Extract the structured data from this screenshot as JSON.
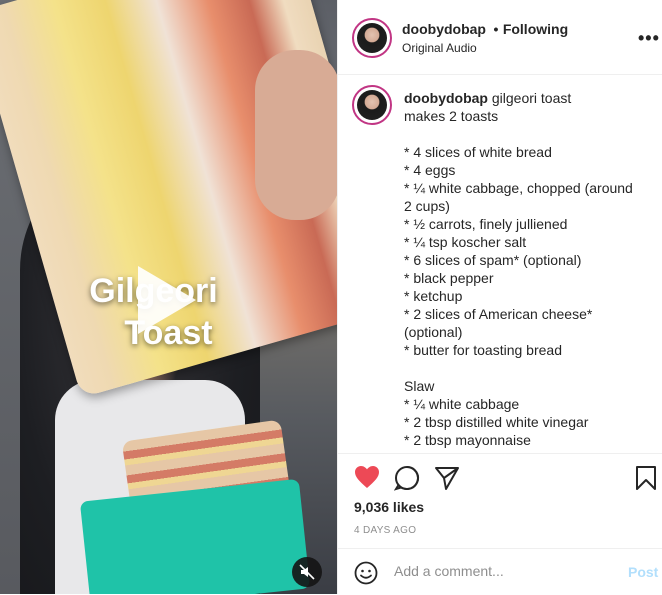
{
  "media": {
    "overlay_line1": "Gilgeori",
    "overlay_line2": "Toast",
    "play_icon": "play-icon",
    "mute_icon": "mute-icon"
  },
  "header": {
    "username": "doobydobap",
    "separator": "•",
    "follow_status": "Following",
    "audio": "Original Audio",
    "more_icon": "more-options-icon"
  },
  "caption": {
    "username": "doobydobap",
    "lines": [
      "gilgeori toast",
      "makes 2 toasts",
      "",
      "* 4 slices of white bread",
      "* 4 eggs",
      "* ¼ white cabbage, chopped (around 2 cups)",
      "* ½ carrots, finely julliened",
      "* ¼ tsp koscher salt",
      "* 6 slices of spam* (optional)",
      "* black pepper",
      "* ketchup",
      "* 2 slices of American cheese* (optional)",
      "* butter for toasting bread",
      "",
      "Slaw",
      "* ¼ white cabbage",
      "* 2 tbsp distilled white vinegar",
      "* 2 tbsp mayonnaise"
    ]
  },
  "actions": {
    "like_icon": "heart-filled-icon",
    "comment_icon": "comment-icon",
    "share_icon": "share-icon",
    "save_icon": "bookmark-icon",
    "like_color": "#ed4956",
    "likes": "9,036 likes",
    "date": "4 DAYS AGO"
  },
  "comment": {
    "emoji_icon": "emoji-icon",
    "placeholder": "Add a comment...",
    "post_label": "Post",
    "post_color": "#b2dffc"
  }
}
